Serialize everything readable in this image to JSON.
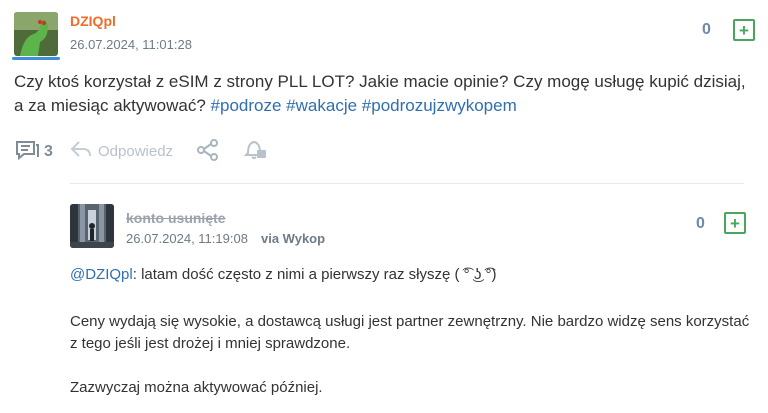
{
  "post": {
    "author": "DZIQpl",
    "timestamp": "26.07.2024, 11:01:28",
    "votes": "0",
    "plus_label": "+",
    "text": "Czy ktoś korzystał z eSIM z strony PLL LOT? Jakie macie opinie? Czy mogę usługę kupić dzisiaj, a za miesiąc aktywować?",
    "tags": [
      "#podroze",
      "#wakacje",
      "#podrozujzwykopem"
    ],
    "comment_count": "3",
    "reply_label": "Odpowiedz"
  },
  "comment": {
    "author": "konto usunięte",
    "timestamp": "26.07.2024, 11:19:08",
    "via": "via Wykop",
    "votes": "0",
    "plus_label": "+",
    "mention": "@DZIQpl",
    "line1_rest": ": latam dość często z nimi a pierwszy raz słyszę ( ͡° ͜ʖ ͡°)",
    "para2": "Ceny wydają się wysokie, a dostawcą usługi jest partner zewnętrzny. Nie bardzo widzę sens korzystać z tego jeśli jest drożej i mniej sprawdzone.",
    "para3": "Zazwyczaj można aktywować później."
  },
  "colors": {
    "accent": "#f26b27",
    "link": "#2f6fb0",
    "plus": "#49a65a"
  }
}
